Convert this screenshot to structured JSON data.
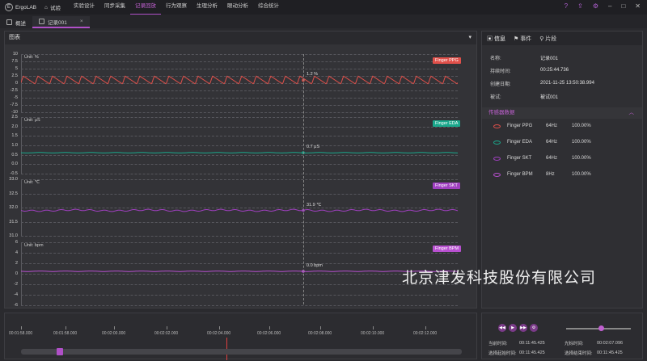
{
  "app": {
    "name": "ErgoLAB",
    "home_label": "试验"
  },
  "menu": [
    "实验设计",
    "同步采集",
    "记录回放",
    "行为观察",
    "生理分析",
    "眼动分析",
    "综合统计"
  ],
  "menu_active_index": 2,
  "tabs": [
    {
      "label": "概述"
    },
    {
      "label": "记录001"
    }
  ],
  "chart_panel": {
    "title": "图表"
  },
  "lanes": [
    {
      "unit": "Unit: %",
      "tag": "Finger PPG",
      "color": "#e0504a",
      "value_label": "1.2 %",
      "yticks": [
        "10",
        "7.5",
        "5",
        "2.5",
        "0",
        "-2.5",
        "-5",
        "-7.5",
        "-10"
      ]
    },
    {
      "unit": "Unit: μS",
      "tag": "Finger EDA",
      "color": "#1aa88c",
      "value_label": "0.7 μS",
      "yticks": [
        "2.5",
        "2.0",
        "1.5",
        "1.0",
        "0.5",
        "0.0",
        "-0.5"
      ]
    },
    {
      "unit": "Unit: ℃",
      "tag": "Finger SKT",
      "color": "#a040c0",
      "value_label": "31.9 ℃",
      "yticks": [
        "33.0",
        "32.5",
        "32.0",
        "31.5",
        "31.0"
      ]
    },
    {
      "unit": "Unit: bpm",
      "tag": "Finger BPM",
      "color": "#b850d0",
      "value_label": "0.0 bpm",
      "yticks": [
        "6",
        "4",
        "2",
        "0",
        "-2",
        "-4",
        "-6"
      ]
    }
  ],
  "timeline": {
    "ticks": [
      "00:01:58.000",
      "00:01:58.000",
      "00:02:00.000",
      "00:02:02.000",
      "00:02:04.000",
      "00:02:06.000",
      "00:02:08.000",
      "00:02:10.000",
      "00:02:12.000"
    ]
  },
  "right_tabs": [
    "信息",
    "事件",
    "片段"
  ],
  "info": [
    {
      "k": "名称:",
      "v": "记录001"
    },
    {
      "k": "持续时间:",
      "v": "00:25:44.736"
    },
    {
      "k": "创建日期:",
      "v": "2021-11-25 13:50:38.994"
    },
    {
      "k": "被试:",
      "v": "被试001"
    }
  ],
  "sensor_header": "传感器数据",
  "sensors": [
    {
      "name": "Finger PPG",
      "hz": "64Hz",
      "pct": "100.00%",
      "color": "#e0504a"
    },
    {
      "name": "Finger EDA",
      "hz": "64Hz",
      "pct": "100.00%",
      "color": "#1aa88c"
    },
    {
      "name": "Finger SKT",
      "hz": "64Hz",
      "pct": "100.00%",
      "color": "#a040c0"
    },
    {
      "name": "Finger BPM",
      "hz": "8Hz",
      "pct": "100.00%",
      "color": "#b850d0"
    }
  ],
  "playback": {
    "current_label": "当前时间:",
    "current_value": "00:11:45.425",
    "cursor_label": "光标时间:",
    "cursor_value": "00:02:07.096",
    "sel_start_label": "选择起始时间:",
    "sel_start_value": "00:11:45.425",
    "sel_end_label": "选择结束时间:",
    "sel_end_value": "00:11:45.425"
  },
  "watermark": "北京津发科技股份有限公司"
}
